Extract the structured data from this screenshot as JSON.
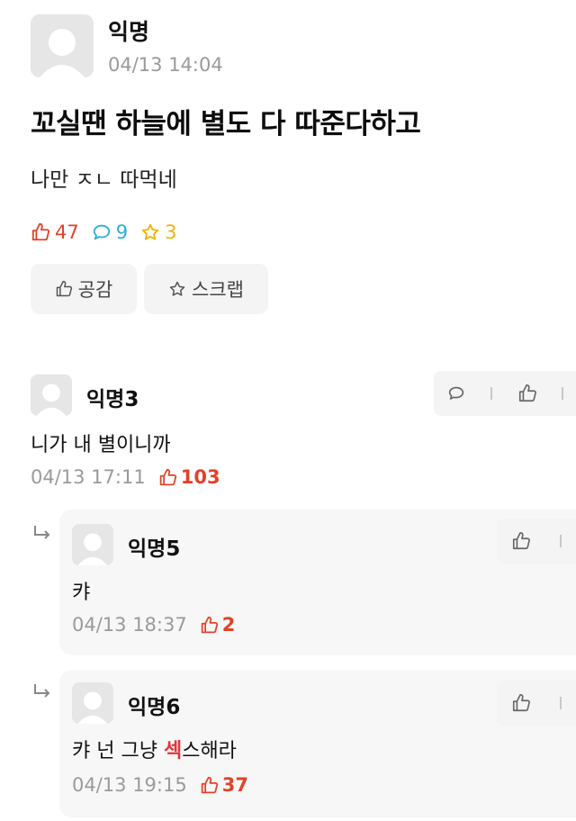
{
  "post": {
    "author": "익명",
    "time": "04/13 14:04",
    "title": "꼬실땐 하늘에 별도 다 따준다하고",
    "body": "나만 ㅈㄴ 따먹네",
    "stats": {
      "likes": "47",
      "comments": "9",
      "scraps": "3"
    },
    "buttons": {
      "like": "공감",
      "scrap": "스크랩"
    }
  },
  "comments": [
    {
      "author": "익명3",
      "text": "니가 내 별이니까",
      "time": "04/13 17:11",
      "likes": "103"
    }
  ],
  "replies": [
    {
      "author": "익명5",
      "text": "캬",
      "time": "04/13 18:37",
      "likes": "2"
    },
    {
      "author": "익명6",
      "text_before": "캬 넌 그냥 ",
      "text_marked": "섹",
      "text_after": "스해라",
      "time": "04/13 19:15",
      "likes": "37"
    }
  ],
  "colors": {
    "like": "#e0432a",
    "comment": "#2ab0d8",
    "scrap": "#f0b400"
  }
}
